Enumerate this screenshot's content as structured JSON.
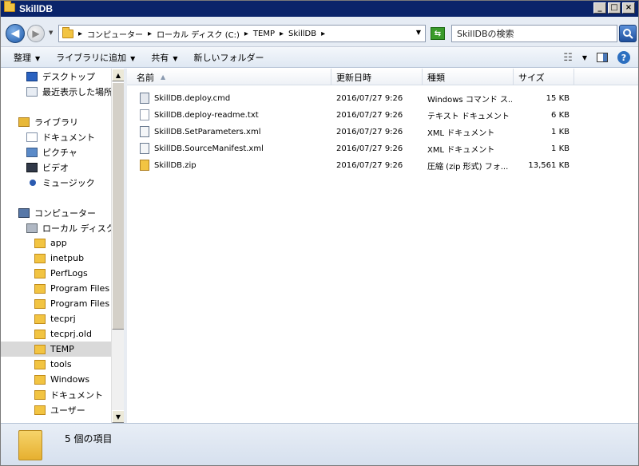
{
  "window": {
    "title": "SkillDB"
  },
  "address": {
    "crumbs": [
      "コンピューター",
      "ローカル ディスク (C:)",
      "TEMP",
      "SkillDB"
    ],
    "separator": "▸"
  },
  "search": {
    "placeholder": "SkillDBの検索"
  },
  "toolbar": {
    "organize": "整理",
    "add_to_library": "ライブラリに追加",
    "share": "共有",
    "new_folder": "新しいフォルダー"
  },
  "nav": {
    "items": [
      {
        "label": "デスクトップ",
        "icon": "desktop-icon"
      },
      {
        "label": "最近表示した場所",
        "icon": "recent-places-icon"
      },
      {
        "label": "ライブラリ",
        "icon": "library-icon"
      },
      {
        "label": "ドキュメント",
        "icon": "documents-icon"
      },
      {
        "label": "ピクチャ",
        "icon": "pictures-icon"
      },
      {
        "label": "ビデオ",
        "icon": "videos-icon"
      },
      {
        "label": "ミュージック",
        "icon": "music-icon"
      },
      {
        "label": "コンピューター",
        "icon": "computer-icon"
      },
      {
        "label": "ローカル ディスク (C",
        "icon": "drive-icon"
      },
      {
        "label": "app",
        "icon": "folder-icon"
      },
      {
        "label": "inetpub",
        "icon": "folder-icon"
      },
      {
        "label": "PerfLogs",
        "icon": "folder-icon"
      },
      {
        "label": "Program Files",
        "icon": "folder-icon"
      },
      {
        "label": "Program Files (:",
        "icon": "folder-icon"
      },
      {
        "label": "tecprj",
        "icon": "folder-icon"
      },
      {
        "label": "tecprj.old",
        "icon": "folder-icon"
      },
      {
        "label": "TEMP",
        "icon": "folder-icon"
      },
      {
        "label": "tools",
        "icon": "folder-icon"
      },
      {
        "label": "Windows",
        "icon": "folder-icon"
      },
      {
        "label": "ドキュメント",
        "icon": "folder-icon"
      },
      {
        "label": "ユーザー",
        "icon": "folder-icon"
      }
    ]
  },
  "columns": {
    "name": "名前",
    "date": "更新日時",
    "type": "種類",
    "size": "サイズ"
  },
  "files": [
    {
      "name": "SkillDB.deploy.cmd",
      "date": "2016/07/27 9:26",
      "type": "Windows コマンド ス...",
      "size": "15 KB",
      "icon": "cmd-file-icon"
    },
    {
      "name": "SkillDB.deploy-readme.txt",
      "date": "2016/07/27 9:26",
      "type": "テキスト ドキュメント",
      "size": "6 KB",
      "icon": "text-file-icon"
    },
    {
      "name": "SkillDB.SetParameters.xml",
      "date": "2016/07/27 9:26",
      "type": "XML ドキュメント",
      "size": "1 KB",
      "icon": "xml-file-icon"
    },
    {
      "name": "SkillDB.SourceManifest.xml",
      "date": "2016/07/27 9:26",
      "type": "XML ドキュメント",
      "size": "1 KB",
      "icon": "xml-file-icon"
    },
    {
      "name": "SkillDB.zip",
      "date": "2016/07/27 9:26",
      "type": "圧縮 (zip 形式) フォ...",
      "size": "13,561 KB",
      "icon": "zip-folder-icon"
    }
  ],
  "status": {
    "count": "5 個の項目"
  },
  "colors": {
    "titlebar": "#0a246a",
    "selected": "#d9d9d9",
    "toolbar": "#dfe8f3"
  }
}
